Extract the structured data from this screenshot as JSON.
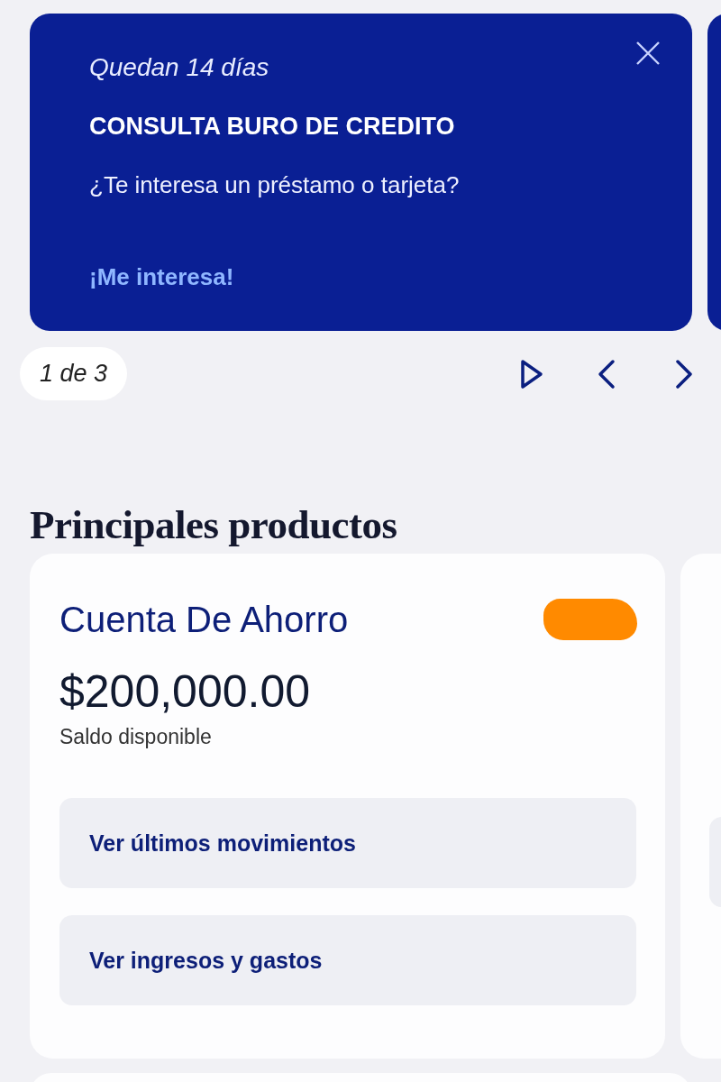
{
  "banner": {
    "countdown": "Quedan 14 días",
    "title": "CONSULTA BURO DE CREDITO",
    "message": "¿Te interesa un préstamo o tarjeta?",
    "action": "¡Me interesa!"
  },
  "pager": {
    "position": "1 de 3"
  },
  "section_title": "Principales productos",
  "product_card": {
    "name": "Cuenta De Ahorro",
    "balance": "$200,000.00",
    "balance_label": "Saldo disponible",
    "actions": [
      {
        "label": "Ver últimos movimientos"
      },
      {
        "label": "Ver ingresos y gastos"
      }
    ]
  }
}
